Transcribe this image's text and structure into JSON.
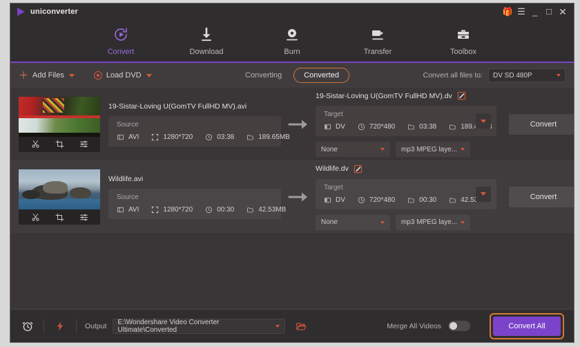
{
  "titlebar": {
    "brand": "uniconverter",
    "gift_icon": "gift-icon",
    "menu_icon": "hamburger-menu-icon",
    "minimize": "_",
    "maximize": "□",
    "close": "✕"
  },
  "nav": {
    "items": [
      {
        "label": "Convert",
        "icon": "convert-icon",
        "active": true
      },
      {
        "label": "Download",
        "icon": "download-icon",
        "active": false
      },
      {
        "label": "Burn",
        "icon": "burn-icon",
        "active": false
      },
      {
        "label": "Transfer",
        "icon": "transfer-icon",
        "active": false
      },
      {
        "label": "Toolbox",
        "icon": "toolbox-icon",
        "active": false
      }
    ],
    "accent": "#7b43c9"
  },
  "toolbar": {
    "add_files": "Add Files",
    "load_dvd": "Load DVD",
    "tabs": [
      {
        "label": "Converting",
        "active": false
      },
      {
        "label": "Converted",
        "active": true
      }
    ],
    "convert_all_label": "Convert all files to:",
    "convert_all_value": "DV SD 480P",
    "accent": "#d4573a"
  },
  "files": [
    {
      "source_name": "19-Sistar-Loving U(GomTV FullHD MV).avi",
      "target_name": "19-Sistar-Loving U(GomTV FullHD MV).dv",
      "source": {
        "caption": "Source",
        "format": "AVI",
        "resolution": "1280*720",
        "duration": "03:38",
        "size": "189.65MB"
      },
      "target": {
        "caption": "Target",
        "format": "DV",
        "resolution": "720*480",
        "duration": "03:38",
        "size": "189.48MB"
      },
      "subtitle_select": "None",
      "audio_select": "mp3 MPEG laye...",
      "convert_label": "Convert"
    },
    {
      "source_name": "Wildlife.avi",
      "target_name": "Wildlife.dv",
      "source": {
        "caption": "Source",
        "format": "AVI",
        "resolution": "1280*720",
        "duration": "00:30",
        "size": "42.53MB"
      },
      "target": {
        "caption": "Target",
        "format": "DV",
        "resolution": "720*480",
        "duration": "00:30",
        "size": "42.53MB"
      },
      "subtitle_select": "None",
      "audio_select": "mp3 MPEG laye...",
      "convert_label": "Convert"
    }
  ],
  "thumb_tools": [
    "trim-icon",
    "crop-icon",
    "effects-icon"
  ],
  "bottom": {
    "clock_icon": "alarm-clock-icon",
    "bolt_icon": "lightning-bolt-icon",
    "output_label": "Output",
    "output_path": "E:\\Wondershare Video Converter Ultimate\\Converted",
    "folder_icon": "open-folder-icon",
    "merge_label": "Merge All Videos",
    "merge_on": false,
    "convert_all": "Convert All",
    "convert_all_color": "#7b43c9",
    "highlight_color": "#d4783a"
  }
}
